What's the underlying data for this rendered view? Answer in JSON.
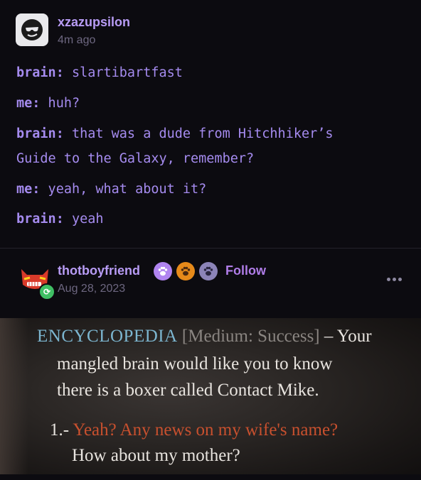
{
  "post1": {
    "username": "xzazupsilon",
    "time": "4m ago",
    "lines": [
      {
        "speaker": "brain:",
        "text": " slartibartfast"
      },
      {
        "speaker": "me:",
        "text": " huh?"
      },
      {
        "speaker": "brain:",
        "text": " that was a dude from Hitchhiker’s"
      },
      {
        "speaker": "",
        "text": "Guide to the Galaxy, remember?"
      },
      {
        "speaker": "me:",
        "text": " yeah, what about it?"
      },
      {
        "speaker": "brain:",
        "text": " yeah"
      }
    ]
  },
  "post2": {
    "username": "thotboyfriend",
    "follow_label": "Follow",
    "time": "Aug 28, 2023"
  },
  "game_text": {
    "encyclopedia": "ENCYCLOPEDIA",
    "check": "[Medium: Success]",
    "dash_your": " – Your",
    "line2": "mangled brain would like you to know",
    "line3": "there is a boxer called Contact Mike.",
    "option_num": "1.-",
    "option_line1": "Yeah? Any news on my wife's name?",
    "option_line2": "How about my mother?"
  },
  "colors": {
    "accent": "#b89cf5",
    "text_purple": "#a58bef",
    "follow": "#b07de8",
    "reblog": "#3fbf64",
    "encyclopedia_blue": "#7cb5cf",
    "option_red": "#c8502e"
  }
}
